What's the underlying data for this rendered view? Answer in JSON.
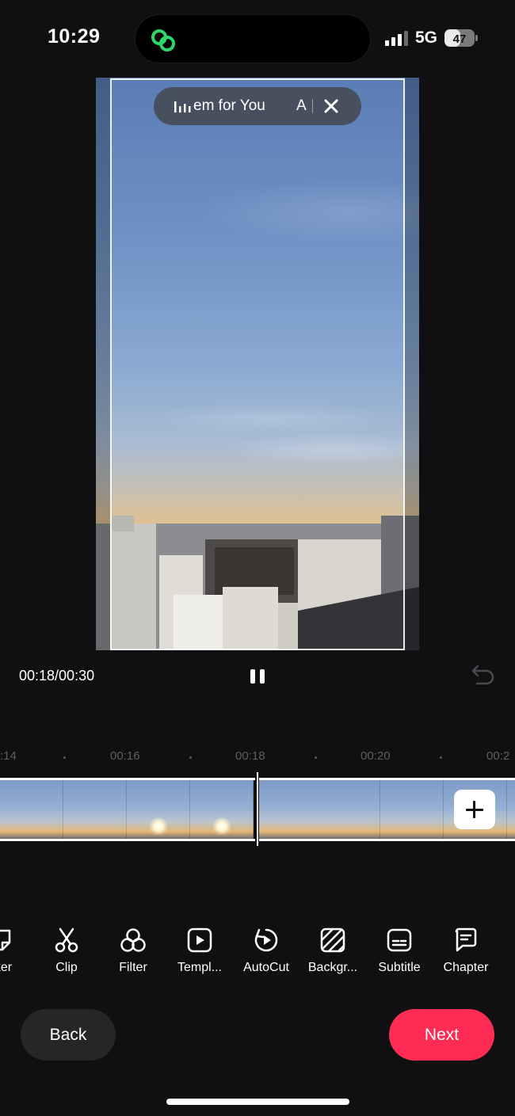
{
  "status_bar": {
    "time": "10:29",
    "network": "5G",
    "battery": "47",
    "island_icon": "link-rings-icon",
    "accent_color": "#2fd46b"
  },
  "preview": {
    "music_pill": {
      "text": "ılı em for You",
      "text_visible": "em for You",
      "letter": "A",
      "close_icon": "close-icon"
    }
  },
  "playback": {
    "timecode": "00:18/00:30",
    "pause_icon": "pause-icon",
    "undo_icon": "undo-icon"
  },
  "timeline": {
    "ticks": [
      ":14",
      "00:16",
      "00:18",
      "00:20",
      "00:2"
    ],
    "add_clip_icon": "plus-icon"
  },
  "tools": [
    {
      "label": "cker",
      "icon": "sticker-icon"
    },
    {
      "label": "Clip",
      "icon": "scissors-icon"
    },
    {
      "label": "Filter",
      "icon": "filter-icon"
    },
    {
      "label": "Templ...",
      "icon": "template-icon"
    },
    {
      "label": "AutoCut",
      "icon": "autocut-icon"
    },
    {
      "label": "Backgr...",
      "icon": "background-icon"
    },
    {
      "label": "Subtitle",
      "icon": "subtitle-icon"
    },
    {
      "label": "Chapter",
      "icon": "chapter-icon"
    }
  ],
  "buttons": {
    "back": "Back",
    "next": "Next",
    "next_color": "#fe2c55"
  }
}
